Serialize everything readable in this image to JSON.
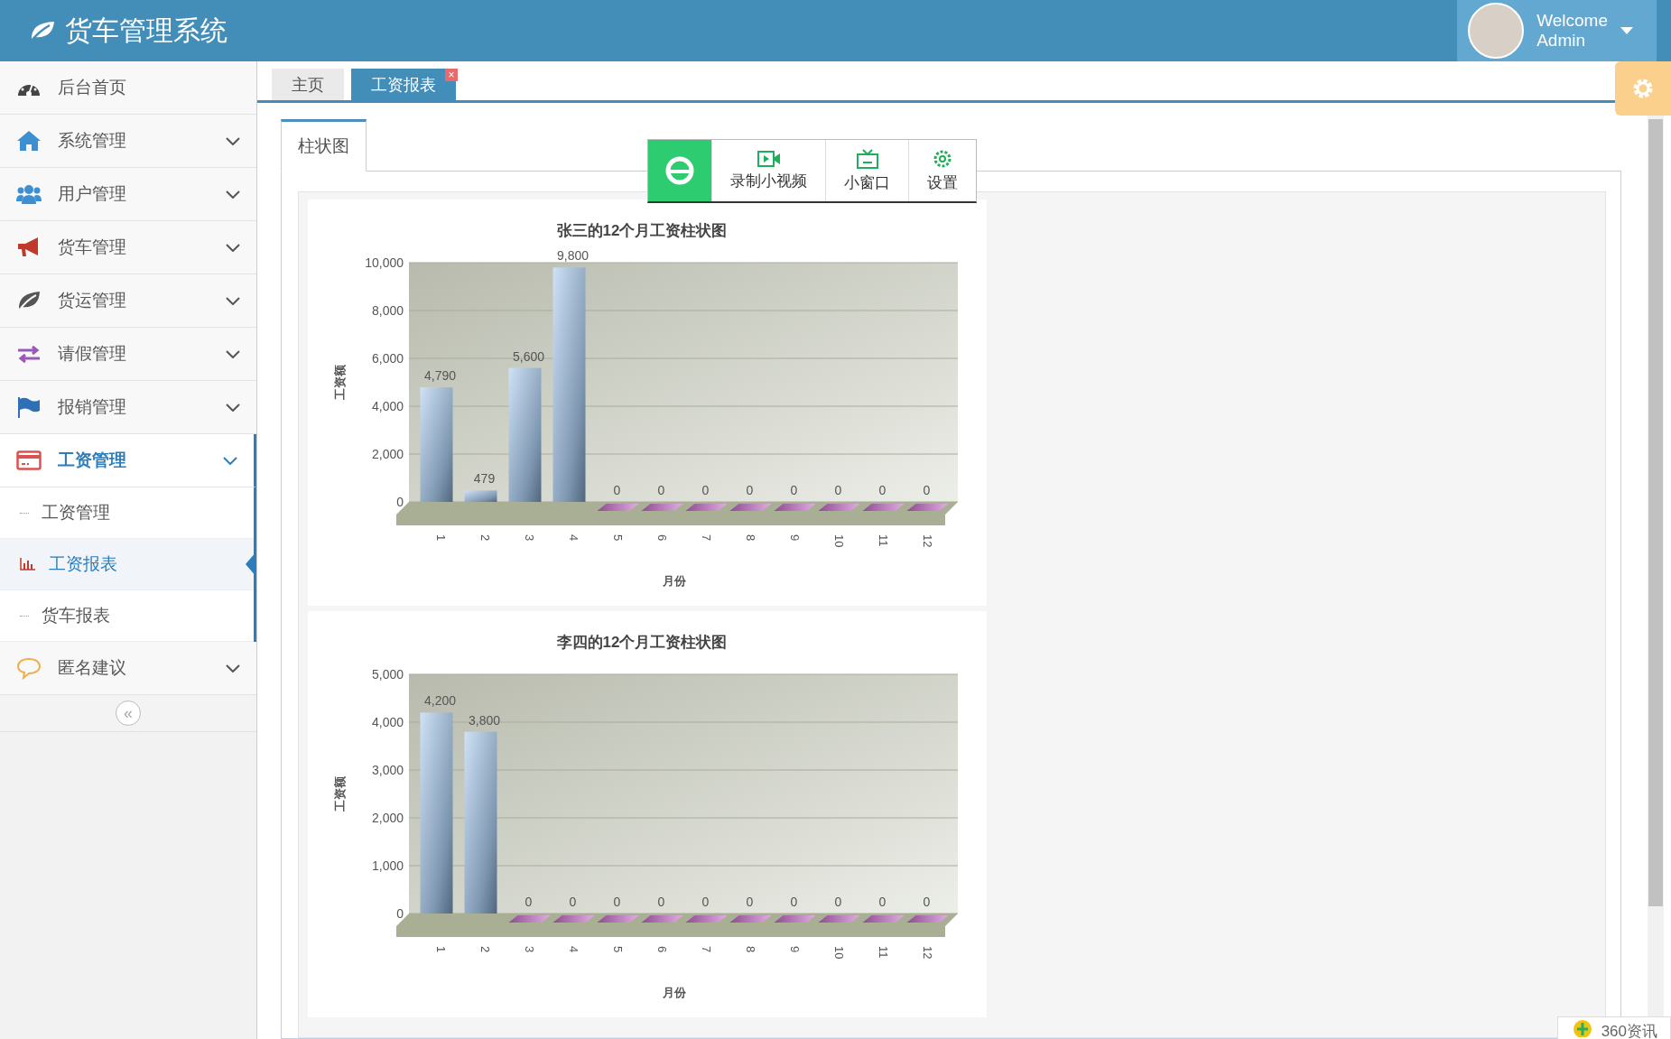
{
  "header": {
    "title": "货车管理系统",
    "user": {
      "greeting": "Welcome",
      "name": "Admin"
    }
  },
  "sidebar": {
    "items": [
      {
        "label": "后台首页",
        "selected": false
      },
      {
        "label": "系统管理",
        "expanded": false,
        "selected": false
      },
      {
        "label": "用户管理",
        "expanded": false,
        "selected": false
      },
      {
        "label": "货车管理",
        "expanded": false,
        "selected": false
      },
      {
        "label": "货运管理",
        "expanded": false,
        "selected": false
      },
      {
        "label": "请假管理",
        "expanded": false,
        "selected": false
      },
      {
        "label": "报销管理",
        "expanded": false,
        "selected": false
      },
      {
        "label": "工资管理",
        "expanded": true,
        "selected": true,
        "children": [
          {
            "label": "工资管理",
            "selected": false
          },
          {
            "label": "工资报表",
            "selected": true
          },
          {
            "label": "货车报表",
            "selected": false
          }
        ]
      },
      {
        "label": "匿名建议",
        "expanded": false,
        "selected": false
      }
    ],
    "collapse": "«"
  },
  "tabs": [
    {
      "label": "主页",
      "selected": false
    },
    {
      "label": "工资报表",
      "selected": true,
      "close": "×"
    }
  ],
  "content": {
    "tabs": [
      {
        "label": "柱状图",
        "selected": true
      }
    ],
    "charts": [
      {
        "chart_data": {
          "type": "bar",
          "title": "张三的12个月工资柱状图",
          "xlabel": "月份",
          "ylabel": "工资额",
          "categories": [
            "1",
            "2",
            "3",
            "4",
            "5",
            "6",
            "7",
            "8",
            "9",
            "10",
            "11",
            "12"
          ],
          "values": [
            4790,
            479,
            5600,
            9800,
            0,
            0,
            0,
            0,
            0,
            0,
            0,
            0
          ],
          "grid": true,
          "ylim": [
            0,
            10000
          ],
          "yticks": [
            {
              "value": 0,
              "label": "0"
            },
            {
              "value": 2000,
              "label": "2,000"
            },
            {
              "value": 4000,
              "label": "4,000"
            },
            {
              "value": 6000,
              "label": "6,000"
            },
            {
              "value": 8000,
              "label": "8,000"
            },
            {
              "value": 10000,
              "label": "10,000"
            }
          ],
          "value_labels": [
            "4,790",
            "479",
            "5,600",
            "9,800",
            "0",
            "0",
            "0",
            "0",
            "0",
            "0",
            "0",
            "0"
          ]
        }
      },
      {
        "chart_data": {
          "type": "bar",
          "title": "李四的12个月工资柱状图",
          "xlabel": "月份",
          "ylabel": "工资额",
          "categories": [
            "1",
            "2",
            "3",
            "4",
            "5",
            "6",
            "7",
            "8",
            "9",
            "10",
            "11",
            "12"
          ],
          "values": [
            4200,
            3800,
            0,
            0,
            0,
            0,
            0,
            0,
            0,
            0,
            0,
            0
          ],
          "grid": true,
          "ylim": [
            0,
            5000
          ],
          "yticks": [
            {
              "value": 0,
              "label": "0"
            },
            {
              "value": 1000,
              "label": "1,000"
            },
            {
              "value": 2000,
              "label": "2,000"
            },
            {
              "value": 3000,
              "label": "3,000"
            },
            {
              "value": 4000,
              "label": "4,000"
            },
            {
              "value": 5000,
              "label": "5,000"
            }
          ],
          "value_labels": [
            "4,200",
            "3,800",
            "0",
            "0",
            "0",
            "0",
            "0",
            "0",
            "0",
            "0",
            "0",
            "0"
          ]
        }
      }
    ]
  },
  "video_toolbar": {
    "buttons": [
      "录制小视频",
      "小窗口",
      "设置"
    ]
  },
  "news_popup": {
    "label": "360资讯"
  }
}
